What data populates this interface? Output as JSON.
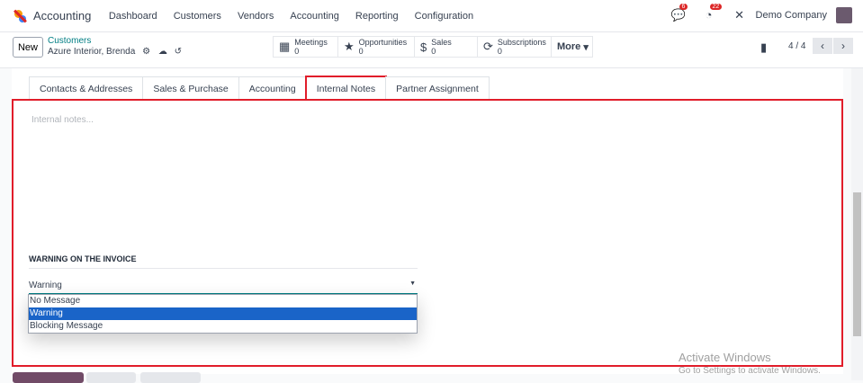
{
  "app": {
    "title": "Accounting",
    "menu": [
      "Dashboard",
      "Customers",
      "Vendors",
      "Accounting",
      "Reporting",
      "Configuration"
    ],
    "messages_count": "6",
    "activities_count": "22",
    "company": "Demo Company"
  },
  "control": {
    "new_label": "New",
    "breadcrumb_parent": "Customers",
    "record_name": "Azure Interior, Brenda",
    "stats": [
      {
        "label": "Meetings",
        "value": "0"
      },
      {
        "label": "Opportunities",
        "value": "0"
      },
      {
        "label": "Sales",
        "value": "0"
      },
      {
        "label": "Subscriptions",
        "value": "0"
      }
    ],
    "more_label": "More",
    "pager": "4 / 4"
  },
  "tabs": [
    "Contacts & Addresses",
    "Sales & Purchase",
    "Accounting",
    "Internal Notes",
    "Partner Assignment"
  ],
  "notes_placeholder": "Internal notes...",
  "warning": {
    "section_title": "WARNING ON THE INVOICE",
    "selected": "Warning",
    "options": [
      "No Message",
      "Warning",
      "Blocking Message"
    ]
  },
  "watermark": {
    "title": "Activate Windows",
    "subtitle": "Go to Settings to activate Windows."
  }
}
